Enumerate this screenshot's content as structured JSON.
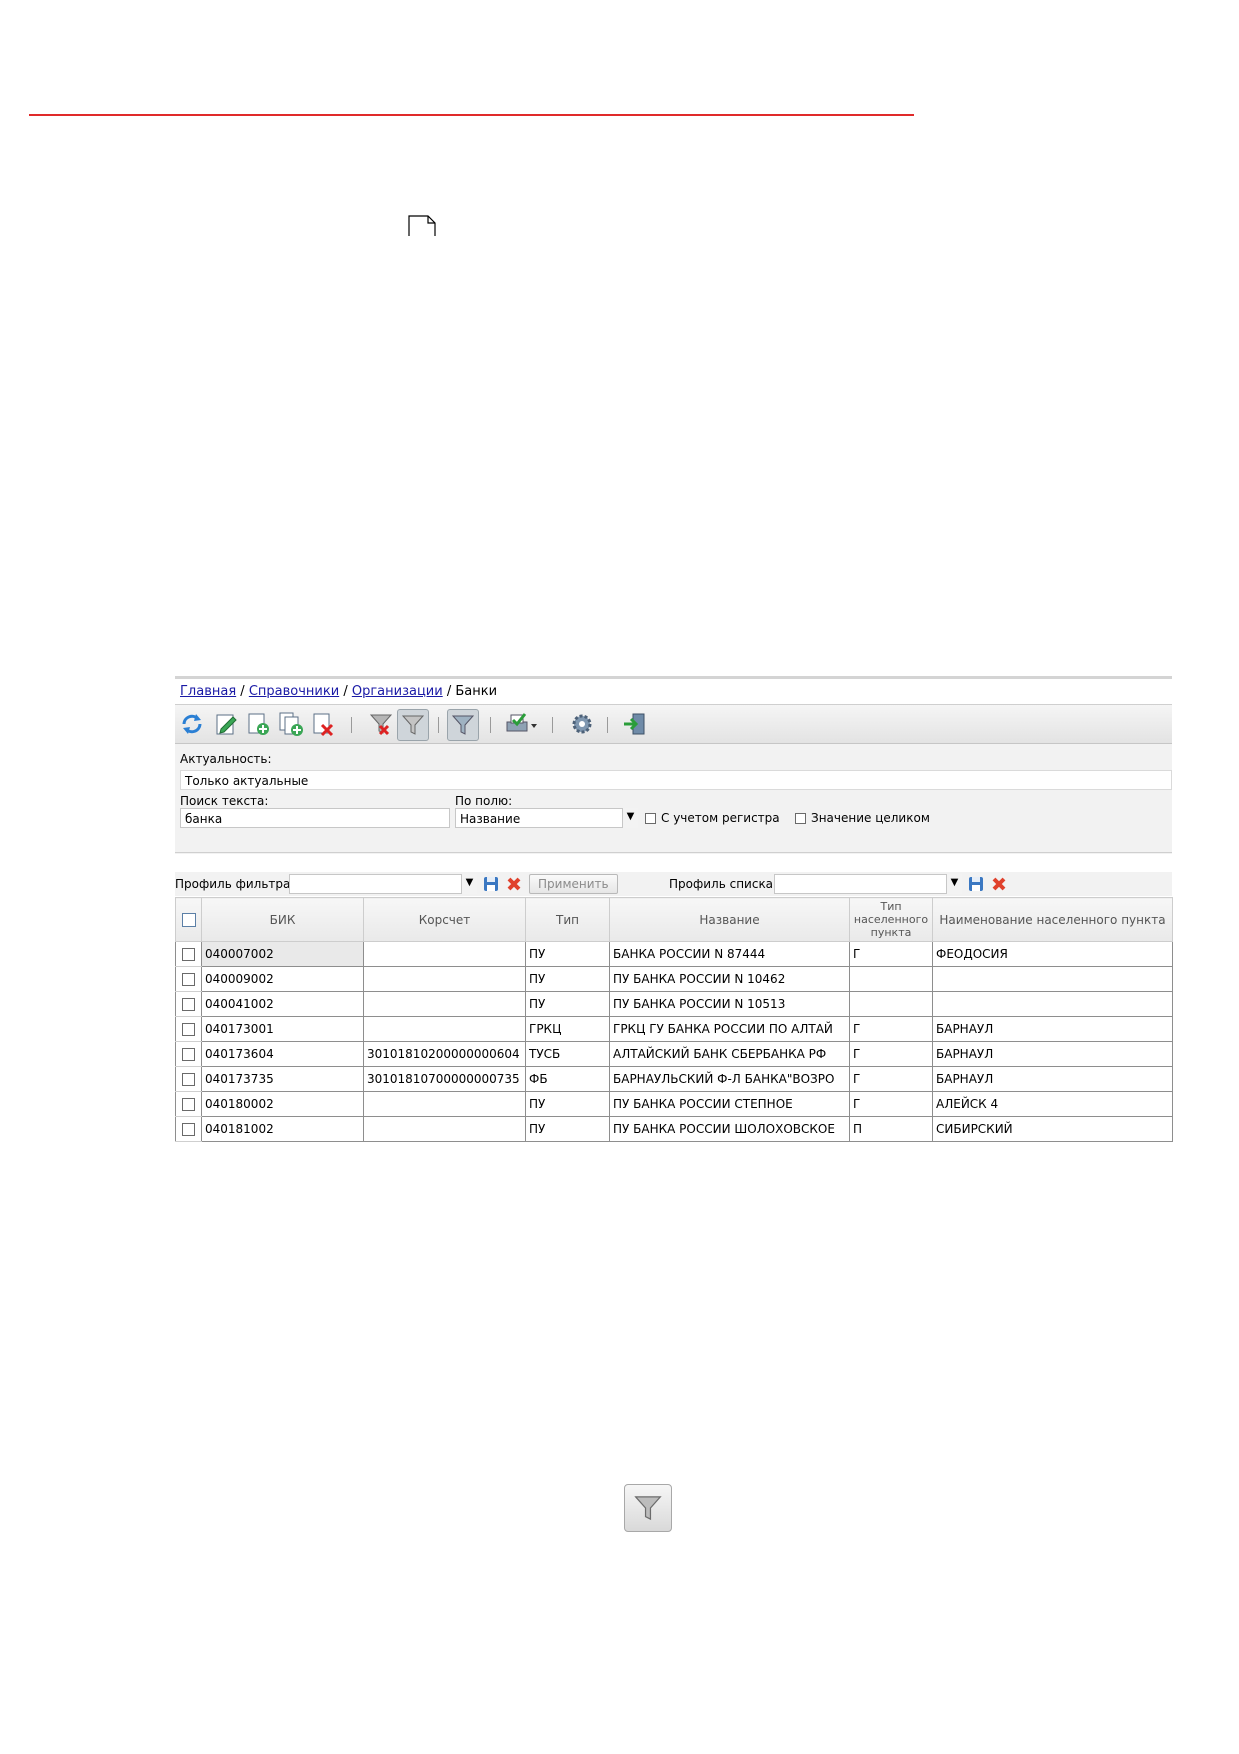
{
  "breadcrumb": {
    "home": "Главная",
    "sep1": "/",
    "refs": "Справочники",
    "sep2": "/",
    "orgs": "Организации",
    "sep3": "/",
    "current": "Банки"
  },
  "toolbar": {
    "icons": [
      "refresh-icon",
      "edit-icon",
      "add-icon",
      "copy-add-icon",
      "delete-icon",
      "clear-filter-icon",
      "filter-icon",
      "filter-active-icon",
      "print-icon",
      "settings-icon",
      "exit-icon"
    ]
  },
  "filter": {
    "actuality_label": "Актуальность:",
    "actuality_value": "Только актуальные",
    "search_label": "Поиск текста:",
    "search_value": "банка",
    "field_label": "По полю:",
    "field_value": "Название",
    "case_label": "С учетом регистра",
    "whole_label": "Значение целиком"
  },
  "profile": {
    "filter_label": "Профиль фильтра",
    "filter_value": "",
    "apply_label": "Применить",
    "list_label": "Профиль списка",
    "list_value": ""
  },
  "table": {
    "headers": {
      "bik": "БИК",
      "korr": "Корсчет",
      "type": "Тип",
      "name": "Название",
      "settlement_type_1": "Тип",
      "settlement_type_2": "населенного",
      "settlement_type_3": "пункта",
      "settlement": "Наименование населенного пункта"
    },
    "rows": [
      {
        "bik": "040007002",
        "korr": "",
        "type": "ПУ",
        "name": "БАНКА РОССИИ N 87444",
        "stype": "Г",
        "settlement": "ФЕОДОСИЯ"
      },
      {
        "bik": "040009002",
        "korr": "",
        "type": "ПУ",
        "name": "ПУ БАНКА РОССИИ N 10462",
        "stype": "",
        "settlement": ""
      },
      {
        "bik": "040041002",
        "korr": "",
        "type": "ПУ",
        "name": "ПУ БАНКА РОССИИ N 10513",
        "stype": "",
        "settlement": ""
      },
      {
        "bik": "040173001",
        "korr": "",
        "type": "ГРКЦ",
        "name": "ГРКЦ ГУ БАНКА РОССИИ ПО АЛТАЙ",
        "stype": "Г",
        "settlement": "БАРНАУЛ"
      },
      {
        "bik": "040173604",
        "korr": "30101810200000000604",
        "type": "ТУСБ",
        "name": "АЛТАЙСКИЙ БАНК СБЕРБАНКА РФ",
        "stype": "Г",
        "settlement": "БАРНАУЛ"
      },
      {
        "bik": "040173735",
        "korr": "30101810700000000735",
        "type": "ФБ",
        "name": "БАРНАУЛЬСКИЙ Ф-Л БАНКА\"ВОЗРО",
        "stype": "Г",
        "settlement": "БАРНАУЛ"
      },
      {
        "bik": "040180002",
        "korr": "",
        "type": "ПУ",
        "name": "ПУ БАНКА РОССИИ СТЕПНОЕ",
        "stype": "Г",
        "settlement": "АЛЕЙСК 4"
      },
      {
        "bik": "040181002",
        "korr": "",
        "type": "ПУ",
        "name": "ПУ БАНКА РОССИИ ШОЛОХОВСКОЕ",
        "stype": "П",
        "settlement": "СИБИРСКИЙ"
      }
    ]
  },
  "colors": {
    "accent_line": "#e02a2a",
    "link": "#1a1aa6"
  }
}
